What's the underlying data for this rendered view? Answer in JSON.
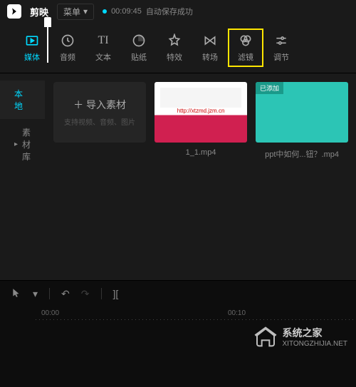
{
  "header": {
    "app_name": "剪映",
    "menu_label": "菜单",
    "save_time": "00:09:45",
    "save_status": "自动保存成功"
  },
  "toolbar": {
    "items": [
      {
        "label": "媒体",
        "icon": "media"
      },
      {
        "label": "音频",
        "icon": "audio"
      },
      {
        "label": "文本",
        "icon": "text"
      },
      {
        "label": "贴纸",
        "icon": "sticker"
      },
      {
        "label": "特效",
        "icon": "effect"
      },
      {
        "label": "转场",
        "icon": "transition"
      },
      {
        "label": "滤镜",
        "icon": "filter"
      },
      {
        "label": "调节",
        "icon": "adjust"
      }
    ]
  },
  "sidebar": {
    "items": [
      {
        "label": "本地"
      },
      {
        "label": "素材库"
      }
    ]
  },
  "import": {
    "label": "导入素材",
    "hint": "支持视频、音频、图片"
  },
  "media": [
    {
      "name": "1_1.mp4",
      "badge": "",
      "url_text": "http://xtzmd.jzm.cn"
    },
    {
      "name": "ppt中如何...钮？.mp4",
      "badge": "已添加"
    }
  ],
  "timeline": {
    "ticks": [
      "00:00",
      "00:10"
    ],
    "playhead_time": "00:00"
  },
  "watermark": {
    "title": "系统之家",
    "url": "XITONGZHIJIA.NET"
  }
}
